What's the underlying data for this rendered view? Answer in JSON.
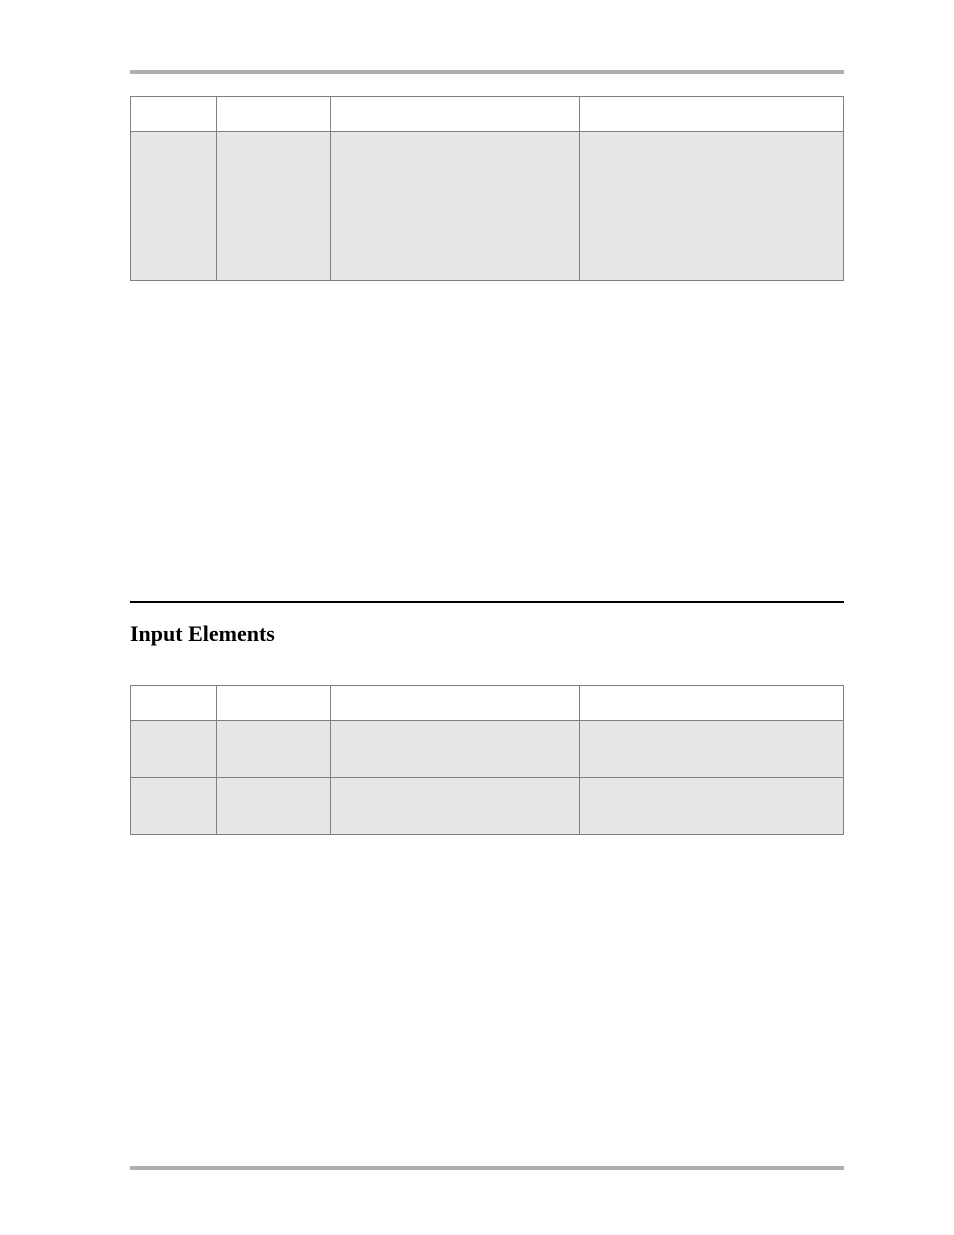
{
  "section": {
    "title": "Input Elements"
  },
  "table1": {
    "headers": [
      "",
      "",
      "",
      ""
    ],
    "row": [
      "",
      "",
      "",
      ""
    ]
  },
  "table2": {
    "headers": [
      "",
      "",
      "",
      ""
    ],
    "rows": [
      [
        "",
        "",
        "",
        ""
      ],
      [
        "",
        "",
        "",
        ""
      ]
    ]
  }
}
